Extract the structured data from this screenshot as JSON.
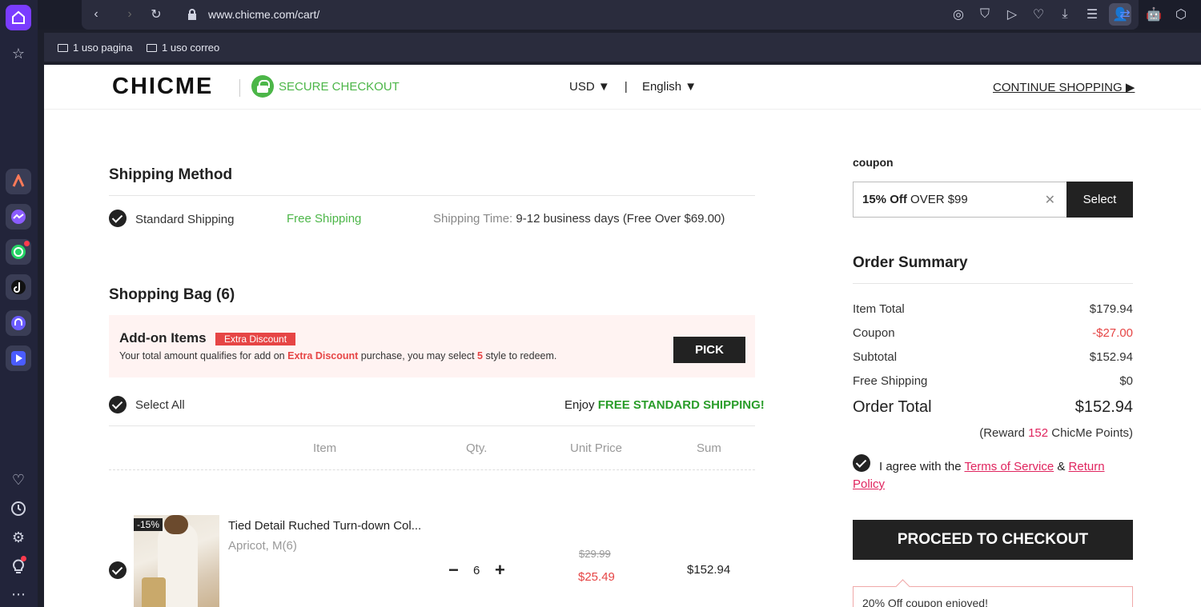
{
  "browser": {
    "url": "www.chicme.com/cart/",
    "bookmarks": [
      "1 uso pagina",
      "1 uso correo"
    ]
  },
  "header": {
    "logo": "CHICME",
    "secure": "SECURE CHECKOUT",
    "currency": "USD ▼",
    "separator": "|",
    "language": "English ▼",
    "continue": "CONTINUE SHOPPING ▶"
  },
  "shipping": {
    "title": "Shipping Method",
    "method": "Standard Shipping",
    "price": "Free Shipping",
    "time_label": "Shipping Time:",
    "time_value": "9-12 business days (Free Over $69.00)"
  },
  "bag": {
    "title": "Shopping Bag (6)",
    "addon_title": "Add-on Items",
    "addon_badge": "Extra Discount",
    "addon_desc_1": "Your total amount qualifies for add on ",
    "addon_desc_red": "Extra Discount",
    "addon_desc_2": " purchase, you may select ",
    "addon_desc_num": "5",
    "addon_desc_3": " style to redeem.",
    "pick": "PICK",
    "select_all": "Select All",
    "enjoy": "Enjoy ",
    "enjoy_green": "FREE STANDARD SHIPPING!",
    "columns": [
      "Item",
      "Qty.",
      "Unit Price",
      "Sum"
    ]
  },
  "product": {
    "discount": "-15%",
    "name": "Tied Detail Ruched Turn-down Col...",
    "variant": "Apricot, M(6)",
    "minus": "−",
    "qty": "6",
    "plus": "+",
    "old_price": "$29.99",
    "price": "$25.49",
    "sum": "$152.94"
  },
  "coupon": {
    "label": "coupon",
    "bold": "15% Off",
    "rest": " OVER $99",
    "clear": "✕",
    "select": "Select"
  },
  "summary": {
    "title": "Order Summary",
    "rows": [
      {
        "label": "Item Total",
        "value": "$179.94"
      },
      {
        "label": "Coupon",
        "value": "-$27.00"
      },
      {
        "label": "Subtotal",
        "value": "$152.94"
      },
      {
        "label": "Free Shipping",
        "value": "$0"
      }
    ],
    "total_label": "Order Total",
    "total_value": "$152.94",
    "reward_1": "(Reward ",
    "reward_pts": "152",
    "reward_2": " ChicMe Points)",
    "agree": "I agree with the ",
    "terms": "Terms of Service",
    "amp": " & ",
    "return1": "Return",
    "return2": "Policy",
    "checkout": "PROCEED TO CHECKOUT",
    "enjoyed": "20% Off coupon enjoyed!"
  },
  "colors": {
    "green": "#4cb648",
    "red": "#e64545",
    "dark": "#222222",
    "link": "#e0245e"
  }
}
